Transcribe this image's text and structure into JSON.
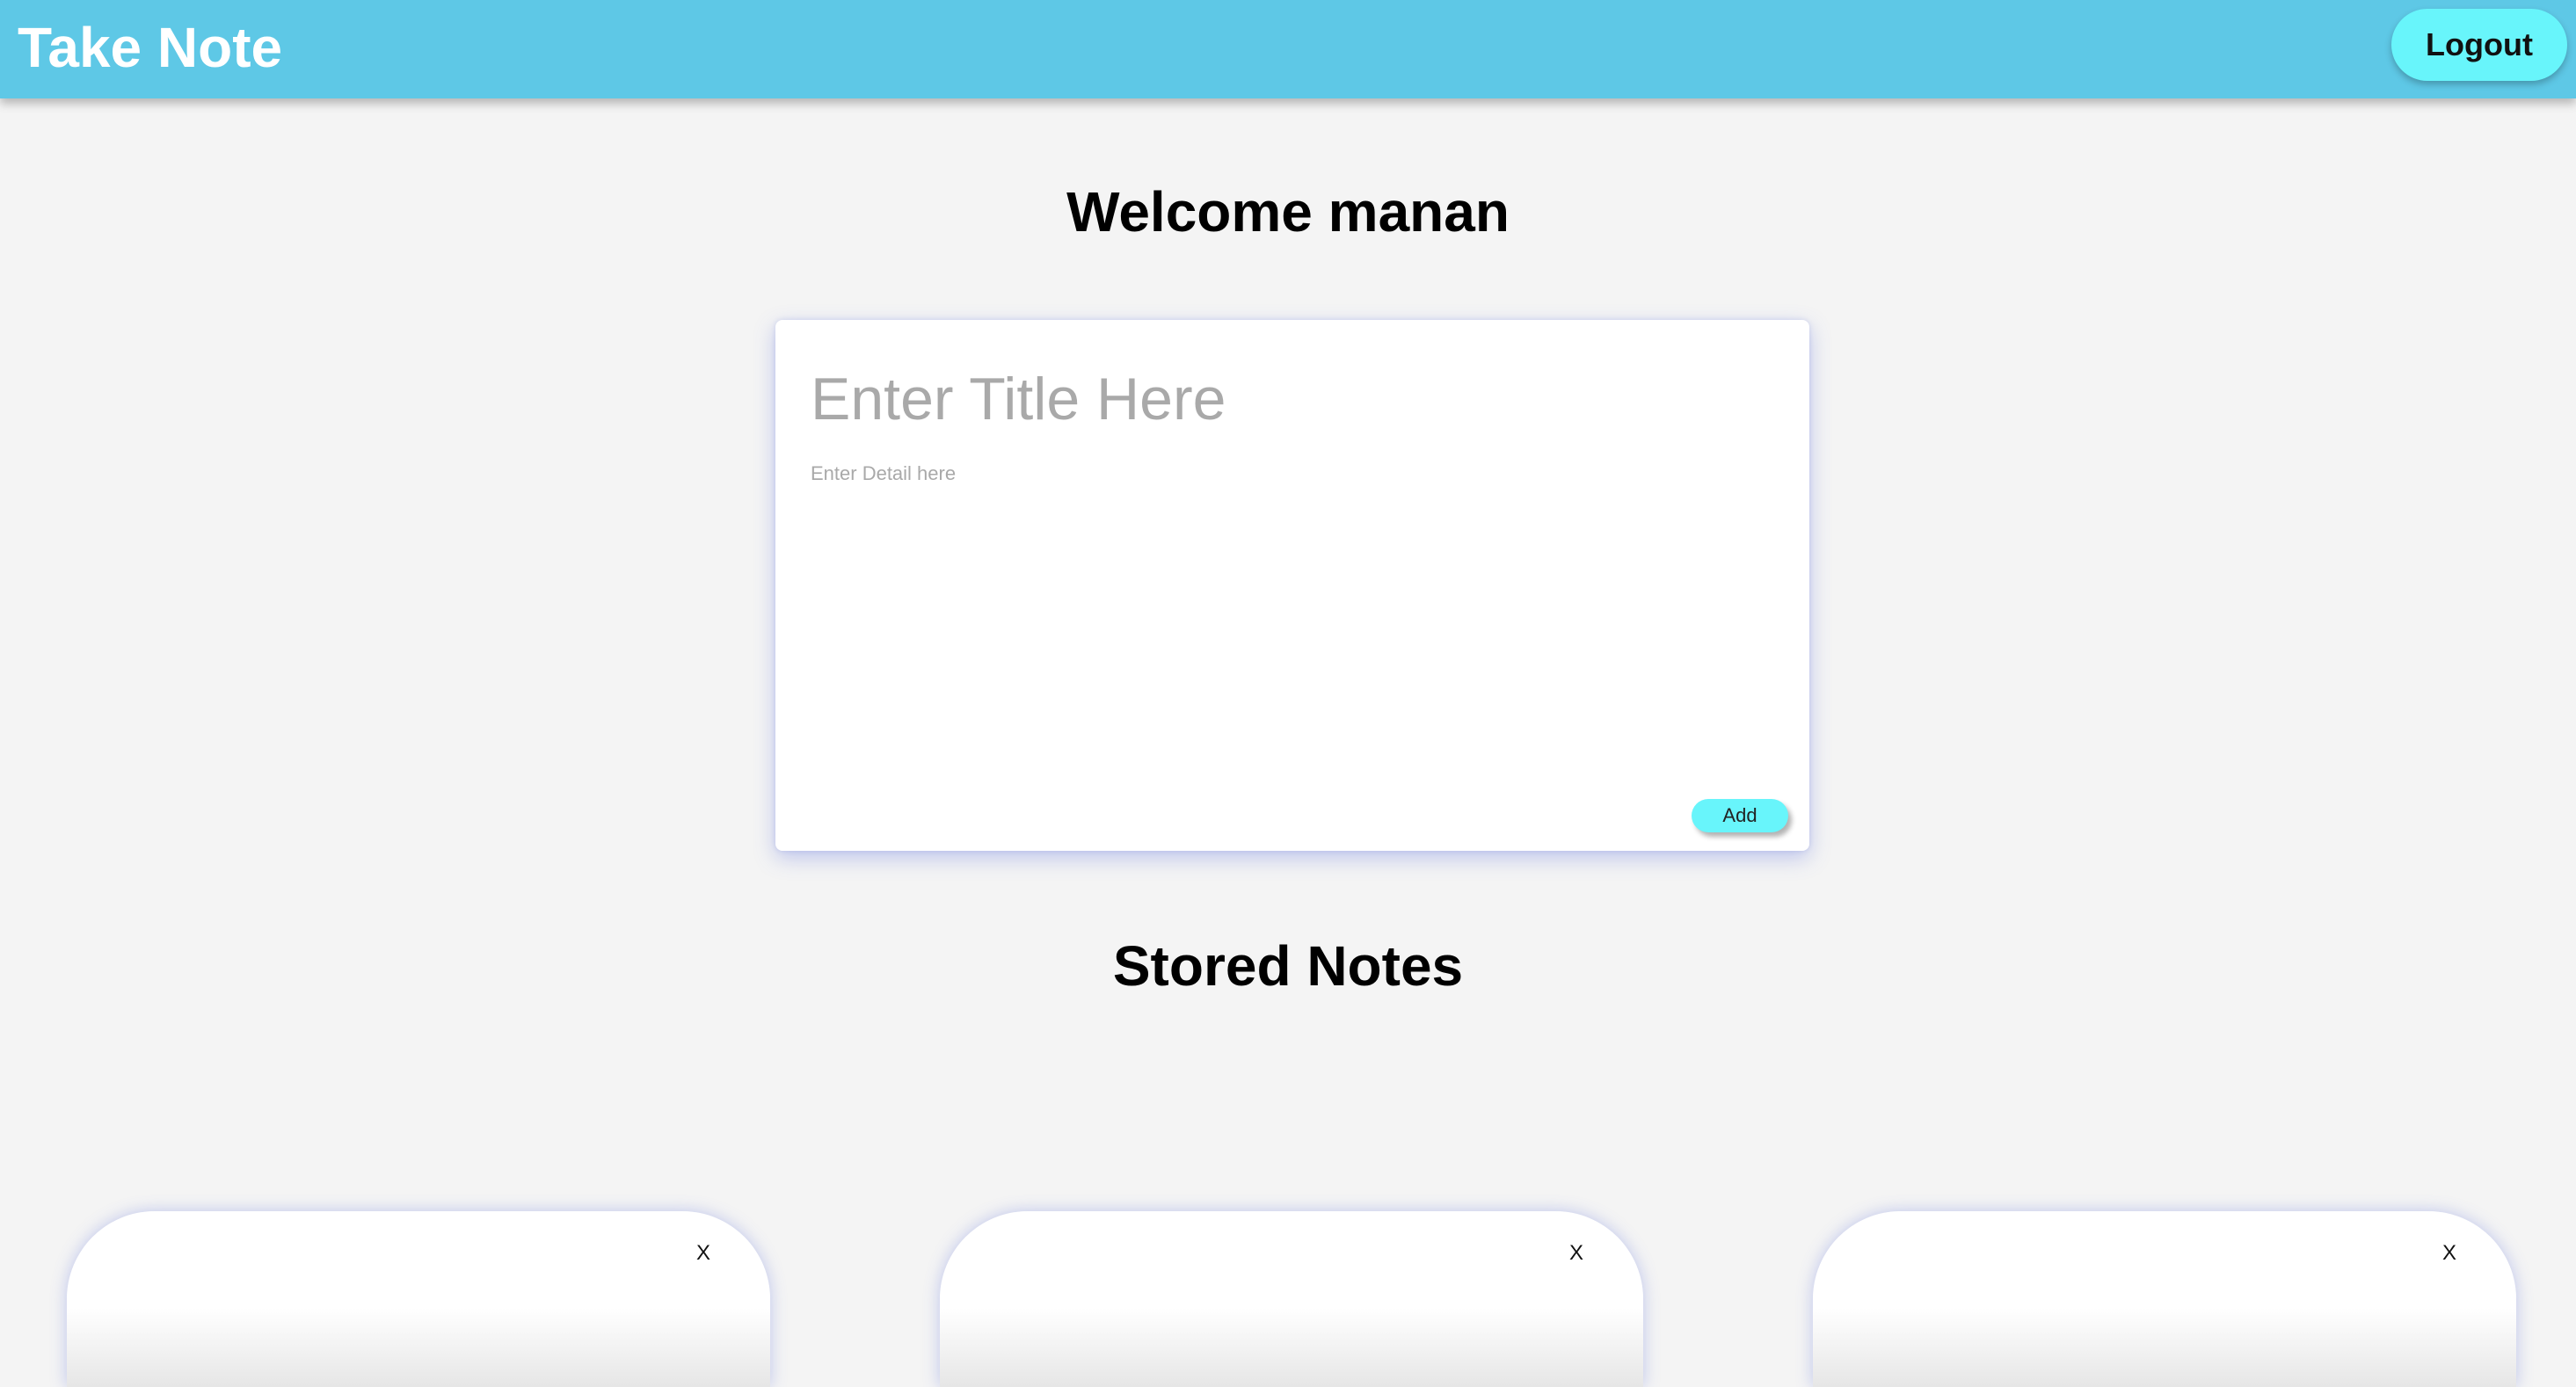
{
  "navbar": {
    "brand": "Take Note",
    "logout_label": "Logout"
  },
  "main": {
    "welcome": "Welcome manan",
    "form": {
      "title_placeholder": "Enter Title Here",
      "title_value": "",
      "detail_placeholder": "Enter Detail here",
      "detail_value": "",
      "add_label": "Add"
    },
    "stored_heading": "Stored Notes",
    "notes": [
      {
        "close_label": "X"
      },
      {
        "close_label": "X"
      },
      {
        "close_label": "X"
      }
    ]
  },
  "colors": {
    "navbar": "#5ec8e6",
    "accent_button": "#68f5fb",
    "background": "#f4f4f4"
  }
}
